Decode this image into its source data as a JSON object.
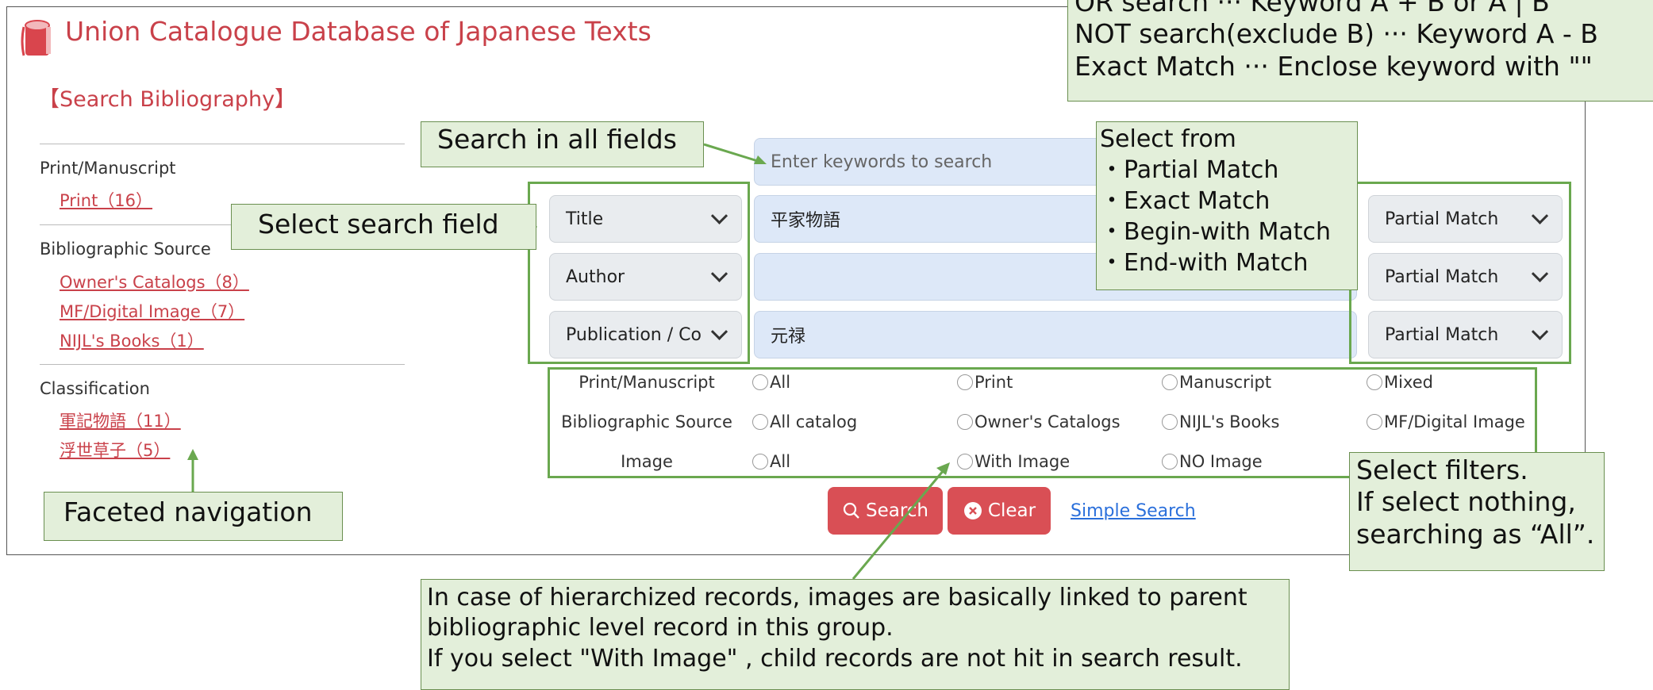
{
  "app": {
    "title": "Union Catalogue Database of Japanese Texts",
    "section_title": "【Search Bibliography】"
  },
  "sidebar": {
    "groups": [
      {
        "heading": "Print/Manuscript",
        "links": [
          "Print（16）"
        ]
      },
      {
        "heading": "Bibliographic Source",
        "links": [
          "Owner's Catalogs（8）",
          "MF/Digital Image（7）",
          "NIJL's Books（1）"
        ]
      },
      {
        "heading": "Classification",
        "links": [
          "軍記物語（11）",
          "浮世草子（5）"
        ]
      }
    ]
  },
  "search": {
    "all_fields_placeholder": "Enter keywords to search",
    "rows": [
      {
        "field": "Title",
        "value": "平家物語",
        "match": "Partial Match"
      },
      {
        "field": "Author",
        "value": "",
        "match": "Partial Match"
      },
      {
        "field": "Publication / Co",
        "value": "元禄",
        "match": "Partial Match"
      }
    ]
  },
  "filters": [
    {
      "label": "Print/Manuscript",
      "options": [
        "All",
        "Print",
        "Manuscript",
        "Mixed"
      ]
    },
    {
      "label": "Bibliographic Source",
      "options": [
        "All catalog",
        "Owner's Catalogs",
        "NIJL's Books",
        "MF/Digital Image"
      ]
    },
    {
      "label": "Image",
      "options": [
        "All",
        "With Image",
        "NO Image"
      ]
    }
  ],
  "actions": {
    "search": "Search",
    "clear": "Clear",
    "simple_search": "Simple Search"
  },
  "annotations": {
    "boolean_help": [
      "OR search ··· Keyword A + B or A | B",
      "NOT search(exclude B) ··· Keyword A - B",
      "Exact Match ··· Enclose keyword with \"\""
    ],
    "search_all_fields": "Search in all fields",
    "select_search_field": "Select search field",
    "match_types": [
      "Select from",
      "・Partial Match",
      "・Exact Match",
      "・Begin-with Match",
      "・End-with Match"
    ],
    "faceted_navigation": "Faceted navigation",
    "select_filters": [
      "Select filters.",
      "If select nothing,",
      "searching as “All”."
    ],
    "hierarchy_note": [
      "In case of hierarchized records, images are basically linked to parent",
      "bibliographic level record in this group.",
      "If you select \"With Image\" , child records are not hit in search result."
    ]
  },
  "colors": {
    "accent": "#c9414a",
    "button": "#d94f55",
    "callout_bg": "#e3efda",
    "highlight_border": "#6aa84f",
    "input_bg": "#dde8f8",
    "select_bg": "#e9ecef"
  }
}
